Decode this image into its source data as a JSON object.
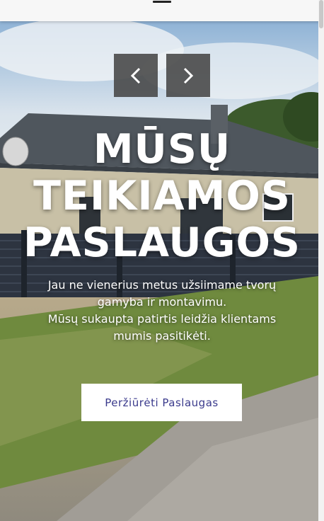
{
  "header": {
    "menu_icon": "hamburger-menu-icon"
  },
  "hero": {
    "prev_icon": "chevron-left-icon",
    "next_icon": "chevron-right-icon",
    "title_lines": [
      "MŪSŲ",
      "TEIKIAMOS",
      "PASLAUGOS"
    ],
    "subtitle_lines": [
      "Jau ne vienerius metus užsiimame tvorų",
      "gamyba ir montavimu.",
      "Mūsų sukaupta patirtis leidžia klientams",
      "mumis pasitikėti."
    ],
    "cta_label": "Peržiūrėti Paslaugas"
  },
  "colors": {
    "cta_text": "#3a3a8c",
    "arrow_bg": "#464646",
    "header_bg": "#f7f7f7"
  }
}
